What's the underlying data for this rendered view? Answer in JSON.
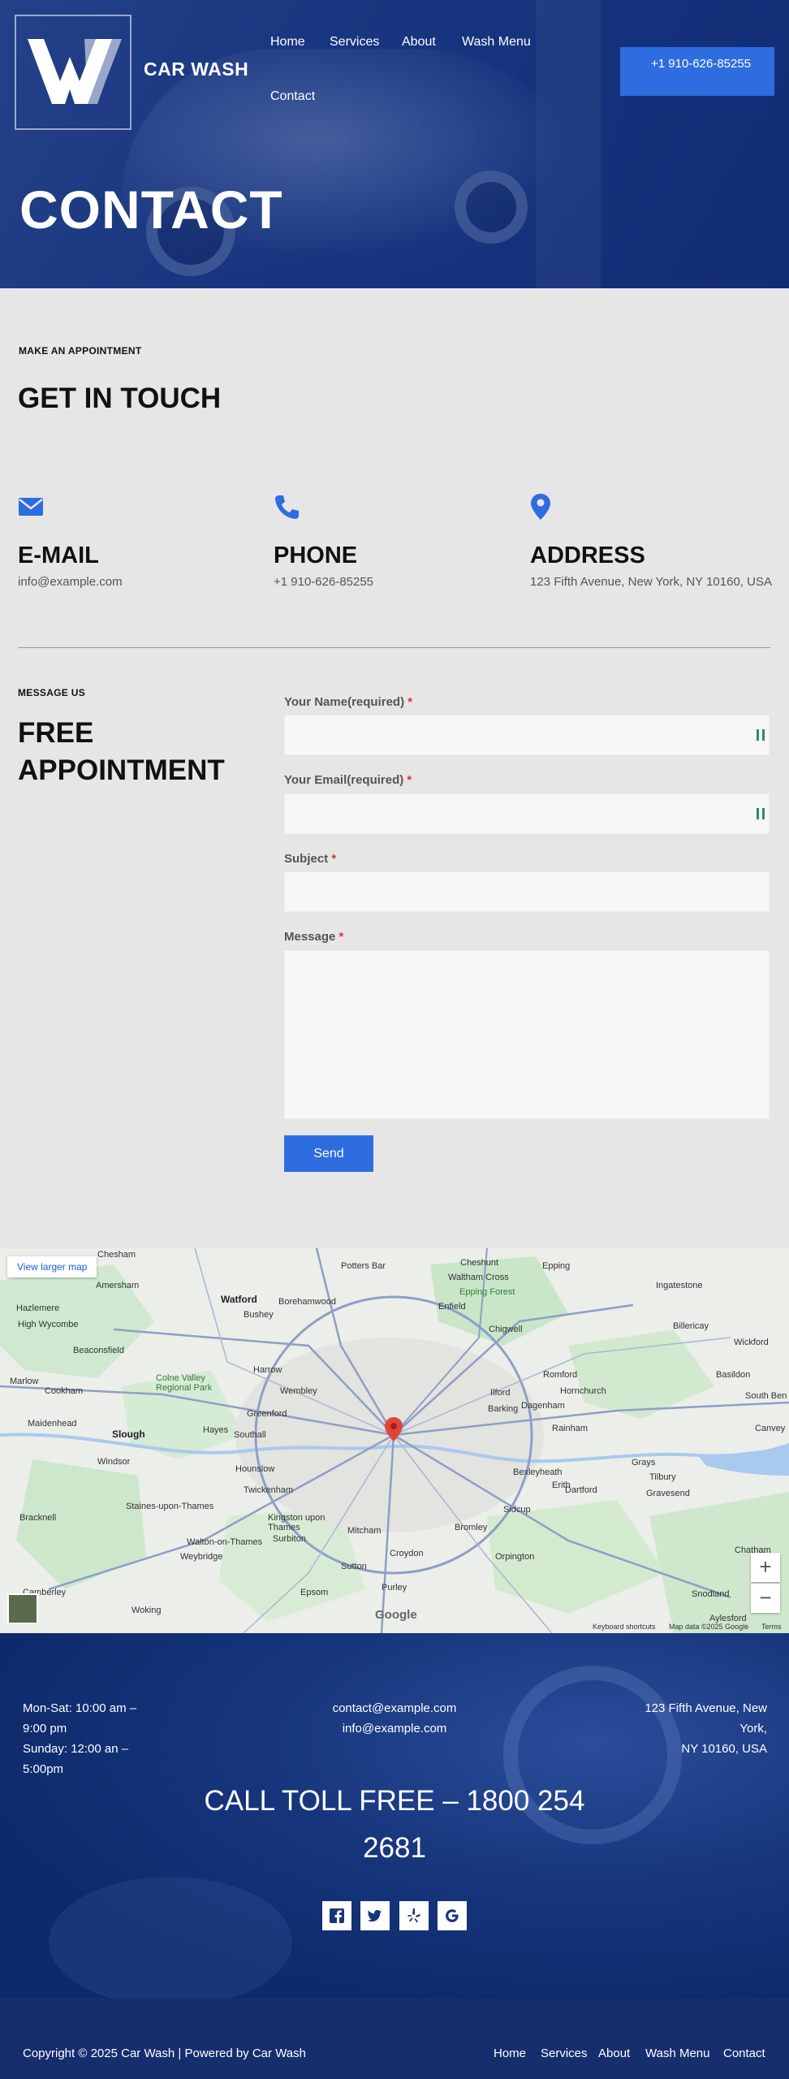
{
  "brand": {
    "name": "CAR WASH"
  },
  "nav": {
    "home": "Home",
    "services": "Services",
    "about": "About",
    "wash_menu": "Wash Menu",
    "contact": "Contact"
  },
  "header": {
    "phone": "+1 910-626-85255"
  },
  "hero": {
    "title": "CONTACT"
  },
  "touch": {
    "eyebrow": "MAKE AN APPOINTMENT",
    "title": "GET IN TOUCH"
  },
  "info": [
    {
      "title": "E-MAIL",
      "text": "info@example.com",
      "icon": "envelope-icon"
    },
    {
      "title": "PHONE",
      "text": "+1 910-626-85255",
      "icon": "phone-icon"
    },
    {
      "title": "ADDRESS",
      "text": "123 Fifth Avenue, New York, NY 10160, USA",
      "icon": "map-pin-icon"
    }
  ],
  "appointment": {
    "eyebrow": "MESSAGE US",
    "title": "FREE APPOINTMENT"
  },
  "form": {
    "name_label": "Your Name(required)",
    "email_label": "Your Email(required)",
    "subject_label": "Subject",
    "message_label": "Message",
    "required_mark": "*",
    "send_label": "Send"
  },
  "map": {
    "view_larger": "View larger map",
    "zoom_in": "+",
    "zoom_out": "−",
    "google": "Google",
    "keyboard": "Keyboard shortcuts",
    "map_data": "Map data ©2025 Google",
    "terms": "Terms",
    "places": {
      "chesham": "Chesham",
      "amersham": "Amersham",
      "watford": "Watford",
      "borehamwood": "Borehamwood",
      "potters_bar": "Potters Bar",
      "cheshunt": "Cheshunt",
      "waltham_cross": "Waltham Cross",
      "enfield": "Enfield",
      "epping": "Epping",
      "epping_forest": "Epping Forest",
      "ingatestone": "Ingatestone",
      "hazlemere": "Hazlemere",
      "bushey": "Bushey",
      "high_wycombe": "High Wycombe",
      "chigwell": "Chigwell",
      "billericay": "Billericay",
      "beaconsfield": "Beaconsfield",
      "harrow": "Harrow",
      "romford": "Romford",
      "wickford": "Wickford",
      "marlow": "Marlow",
      "colne_valley": "Colne Valley Regional Park",
      "wembley": "Wembley",
      "ilford": "Ilford",
      "barking": "Barking",
      "dagenham": "Dagenham",
      "hornchurch": "Hornchurch",
      "basildon": "Basildon",
      "cookham": "Cookham",
      "south_ben": "South Ben",
      "maidenhead": "Maidenhead",
      "slough": "Slough",
      "hayes": "Hayes",
      "southall": "Southall",
      "greenford": "Greenford",
      "rainham": "Rainham",
      "canvey": "Canvey",
      "windsor": "Windsor",
      "hounslow": "Hounslow",
      "erith": "Erith",
      "grays": "Grays",
      "tilbury": "Tilbury",
      "twickenham": "Twickenham",
      "bexleyheath": "Bexleyheath",
      "dartford": "Dartford",
      "gravesend": "Gravesend",
      "bracknell": "Bracknell",
      "staines": "Staines-upon-Thames",
      "kingston": "Kingston upon Thames",
      "surbiton": "Surbiton",
      "mitcham": "Mitcham",
      "bromley": "Bromley",
      "sidcup": "Sidcup",
      "walton": "Walton-on-Thames",
      "weybridge": "Weybridge",
      "croydon": "Croydon",
      "orpington": "Orpington",
      "chatham": "Chatham",
      "sutton": "Sutton",
      "epsom": "Epsom",
      "purley": "Purley",
      "camberley": "Camberley",
      "snodland": "Snodland",
      "woking": "Woking",
      "aylesford": "Aylesford"
    }
  },
  "footer": {
    "hours_1": "Mon-Sat: 10:00 am – 9:00 pm",
    "hours_2": "Sunday: 12:00 an – 5:00pm",
    "email_1": "contact@example.com",
    "email_2": "info@example.com",
    "address_1": "123 Fifth Avenue, New York,",
    "address_2": "NY 10160, USA",
    "toll": "CALL TOLL FREE – 1800 254 2681",
    "social": [
      "facebook-icon",
      "twitter-icon",
      "yelp-icon",
      "google-icon"
    ],
    "copyright": "Copyright © 2025 Car Wash | Powered by Car Wash"
  }
}
